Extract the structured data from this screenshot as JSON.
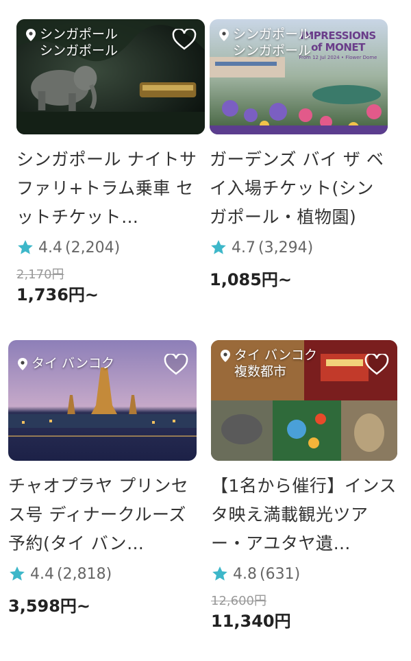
{
  "cards": [
    {
      "location_lines": [
        "シンガポール",
        "シンガポール"
      ],
      "title": "シンガポール ナイトサファリ+トラム乗車 セットチケット…",
      "rating": "4.4",
      "reviews": "(2,204)",
      "old_price": "2,170円",
      "price": "1,736円~",
      "image_desc_icon": "elephant-night-photo"
    },
    {
      "location_lines": [
        "シンガポール",
        "シンガポール"
      ],
      "title": "ガーデンズ バイ ザ ベイ入場チケット(シンガポール・植物園)",
      "rating": "4.7",
      "reviews": "(3,294)",
      "old_price": "",
      "price": "1,085円~",
      "banner_title": "IMPRESSIONS of MONET",
      "banner_sub": "From 12 Jul 2024 • Flower Dome"
    },
    {
      "location_lines": [
        "タイ バンコク"
      ],
      "title": "チャオプラヤ プリンセス号 ディナークルーズ予約(タイ バン…",
      "rating": "4.4",
      "reviews": "(2,818)",
      "old_price": "",
      "price": "3,598円~"
    },
    {
      "location_lines": [
        "タイ バンコク",
        "複数都市"
      ],
      "title": "【1名から催行】インスタ映え満載観光ツアー・アユタヤ遺…",
      "rating": "4.8",
      "reviews": "(631)",
      "old_price": "12,600円",
      "price": "11,340円"
    }
  ],
  "colors": {
    "star": "#3db7c9",
    "heart": "#ffffff"
  }
}
